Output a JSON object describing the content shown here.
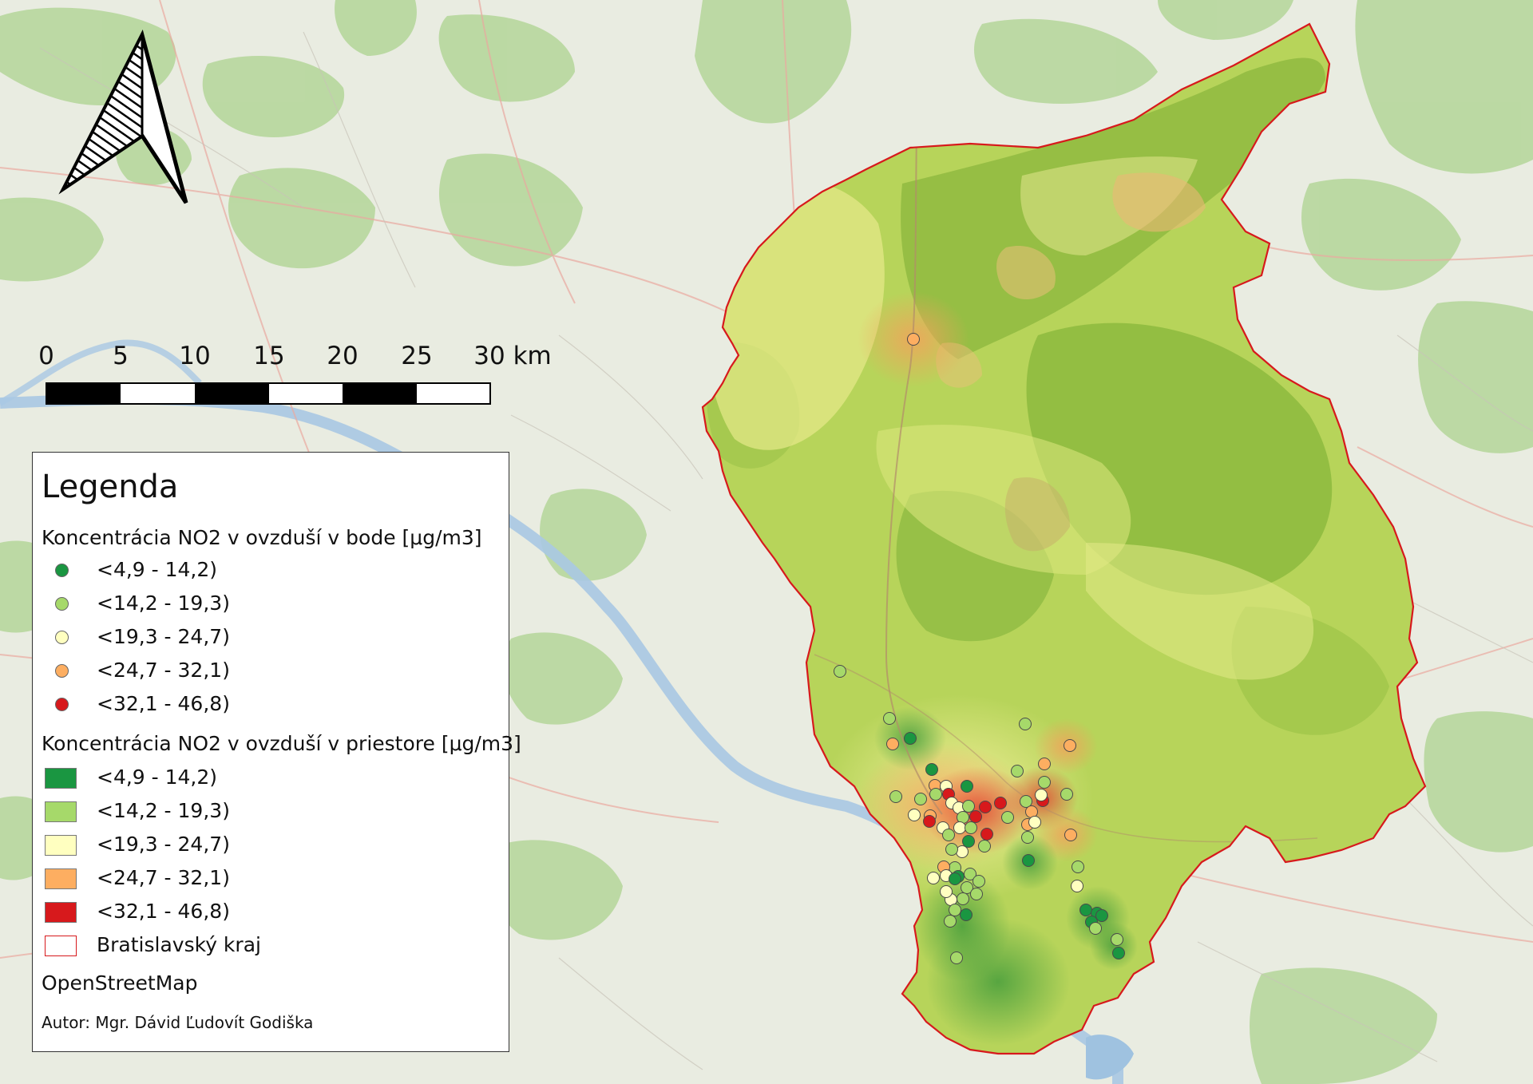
{
  "north_arrow": {
    "icon": "north-arrow-icon"
  },
  "scale_bar": {
    "ticks": [
      "0",
      "5",
      "10",
      "15",
      "20",
      "25",
      "30 km"
    ]
  },
  "legend": {
    "title": "Legenda",
    "point_section": {
      "title": "Koncentrácia NO2 v ovzduší v bode [μg/m3]",
      "items": [
        {
          "label": "<4,9 - 14,2)",
          "color": "#1a9641"
        },
        {
          "label": "<14,2 - 19,3)",
          "color": "#a6d96a"
        },
        {
          "label": "<19,3 - 24,7)",
          "color": "#ffffc0"
        },
        {
          "label": "<24,7 - 32,1)",
          "color": "#fdae61"
        },
        {
          "label": "<32,1 - 46,8)",
          "color": "#d7191c"
        }
      ]
    },
    "area_section": {
      "title": "Koncentrácia NO2 v ovzduší v priestore [μg/m3]",
      "items": [
        {
          "label": "<4,9 - 14,2)",
          "color": "#1a9641"
        },
        {
          "label": "<14,2 - 19,3)",
          "color": "#a6d96a"
        },
        {
          "label": "<19,3 - 24,7)",
          "color": "#ffffc0"
        },
        {
          "label": "<24,7 - 32,1)",
          "color": "#fdae61"
        },
        {
          "label": "<32,1 - 46,8)",
          "color": "#d7191c"
        }
      ]
    },
    "boundary_label": "Bratislavský kraj",
    "boundary_color": "#d7191c",
    "basemap_label": "OpenStreetMap",
    "author": "Autor: Mgr. Dávid Ľudovít Godiška"
  },
  "colors": {
    "region_fill": "#b9d65a",
    "boundary": "#d7191c",
    "basemap": "#e8ebe0",
    "forest": "#b7d79c",
    "water": "#a9c8e3"
  }
}
